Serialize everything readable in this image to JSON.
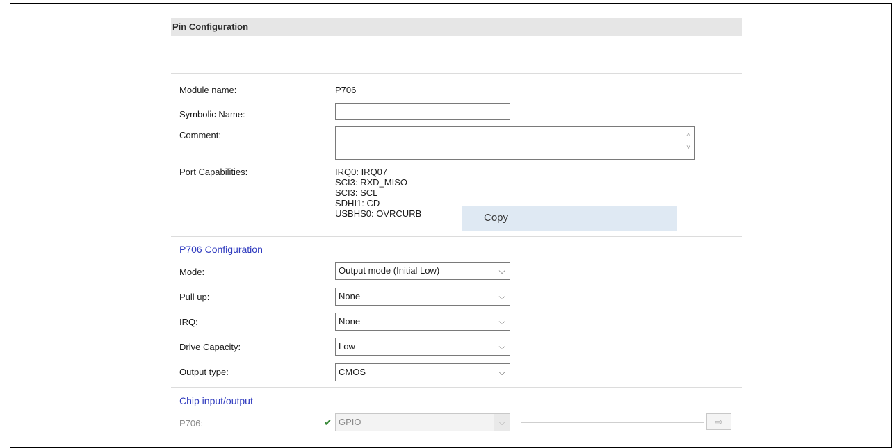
{
  "pin_config": {
    "title": "Pin Configuration",
    "module_name_label": "Module name:",
    "module_name_value": "P706",
    "symbolic_name_label": "Symbolic Name:",
    "symbolic_name_value": "",
    "comment_label": "Comment:",
    "comment_value": "",
    "port_capabilities_label": "Port Capabilities:",
    "port_capabilities": [
      "IRQ0: IRQ07",
      "SCI3: RXD_MISO",
      "SCI3: SCL",
      "SDHI1: CD",
      "USBHS0: OVRCURB"
    ]
  },
  "context_menu": {
    "copy_label": "Copy"
  },
  "p706_config": {
    "title": "P706 Configuration",
    "mode_label": "Mode:",
    "mode_value": "Output mode (Initial Low)",
    "pull_up_label": "Pull up:",
    "pull_up_value": "None",
    "irq_label": "IRQ:",
    "irq_value": "None",
    "drive_capacity_label": "Drive Capacity:",
    "drive_capacity_value": "Low",
    "output_type_label": "Output type:",
    "output_type_value": "CMOS"
  },
  "chip_io": {
    "title": "Chip input/output",
    "pin_label": "P706:",
    "pin_value": "GPIO",
    "check_icon": "✔",
    "arrow_icon": "⇨"
  },
  "icons": {
    "chevron": "⌵",
    "scroll_up": "˄",
    "scroll_down": "˅"
  }
}
